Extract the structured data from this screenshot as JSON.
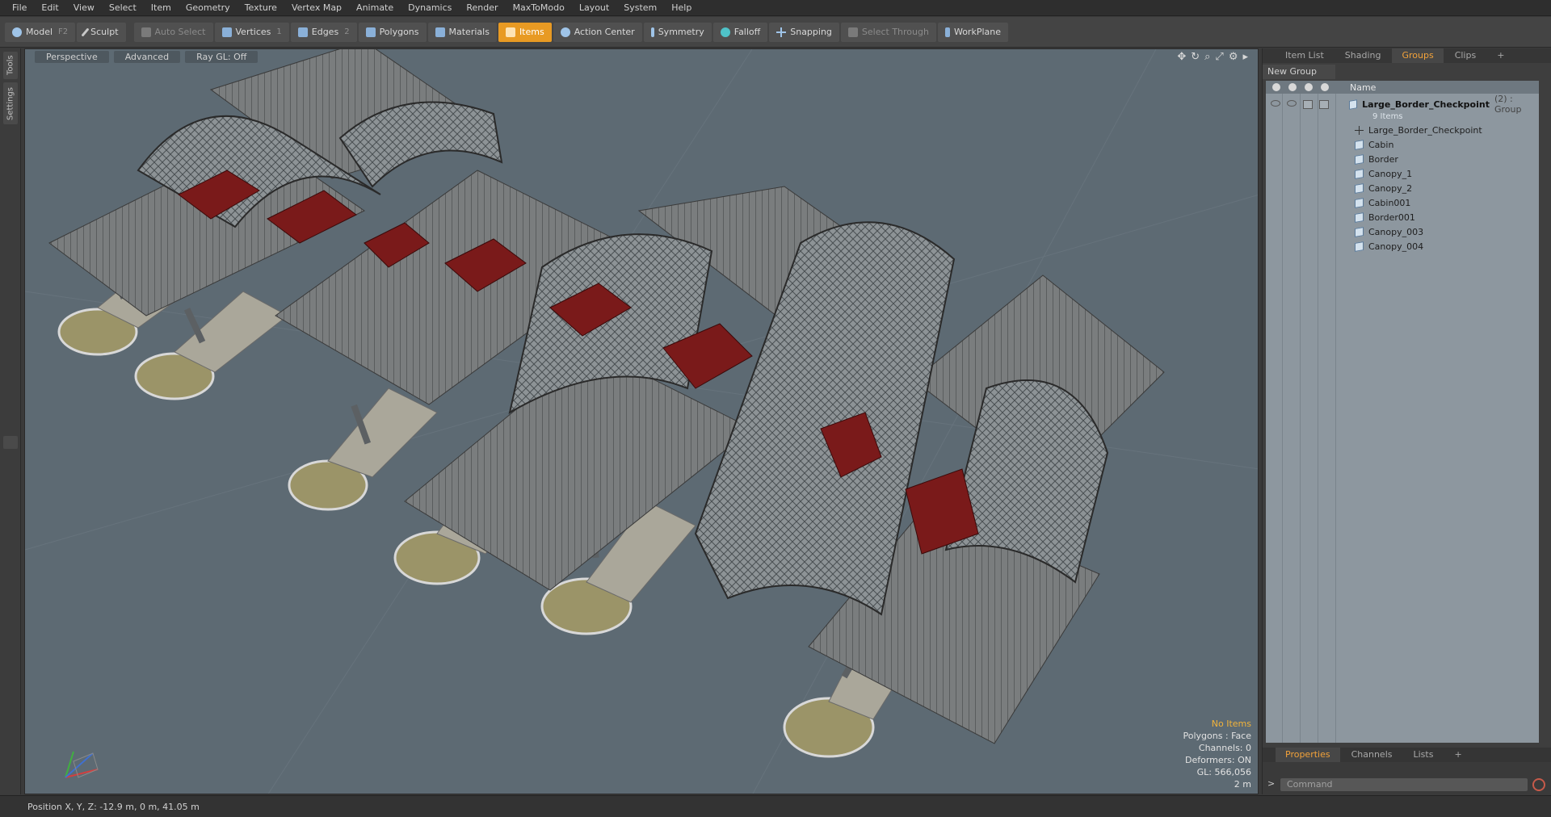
{
  "menu": [
    "File",
    "Edit",
    "View",
    "Select",
    "Item",
    "Geometry",
    "Texture",
    "Vertex Map",
    "Animate",
    "Dynamics",
    "Render",
    "MaxToModo",
    "Layout",
    "System",
    "Help"
  ],
  "toolbar": {
    "model": "Model",
    "model_key": "F2",
    "sculpt": "Sculpt",
    "auto_select": "Auto Select",
    "vertices": "Vertices",
    "vertices_key": "1",
    "edges": "Edges",
    "edges_key": "2",
    "polygons": "Polygons",
    "materials": "Materials",
    "items": "Items",
    "action_center": "Action Center",
    "symmetry": "Symmetry",
    "falloff": "Falloff",
    "snapping": "Snapping",
    "select_through": "Select Through",
    "workplane": "WorkPlane",
    "accent": "#e89a23"
  },
  "left_tabs": [
    "Tools",
    "Settings"
  ],
  "viewport": {
    "view": "Perspective",
    "mode": "Advanced",
    "raygl": "Ray GL: Off",
    "background": "#5d6a73",
    "info": {
      "selection": "No Items",
      "polygons": "Polygons : Face",
      "channels": "Channels: 0",
      "deformers": "Deformers: ON",
      "gl": "GL: 566,056",
      "scale": "2 m"
    }
  },
  "status": {
    "position": "Position X, Y, Z:   -12.9 m, 0 m, 41.05 m"
  },
  "panel": {
    "tabs": [
      "Item List",
      "Shading",
      "Groups",
      "Clips",
      "+"
    ],
    "active_tab": "Groups",
    "new_group": "New Group",
    "column_name": "Name",
    "group": {
      "name": "Large_Border_Checkpoint",
      "suffix": "(2) : Group",
      "count": "9 Items"
    },
    "items": [
      "Large_Border_Checkpoint",
      "Cabin",
      "Border",
      "Canopy_1",
      "Canopy_2",
      "Cabin001",
      "Border001",
      "Canopy_003",
      "Canopy_004"
    ],
    "bottom_tabs": [
      "Properties",
      "Channels",
      "Lists",
      "+"
    ],
    "command_placeholder": "Command"
  }
}
